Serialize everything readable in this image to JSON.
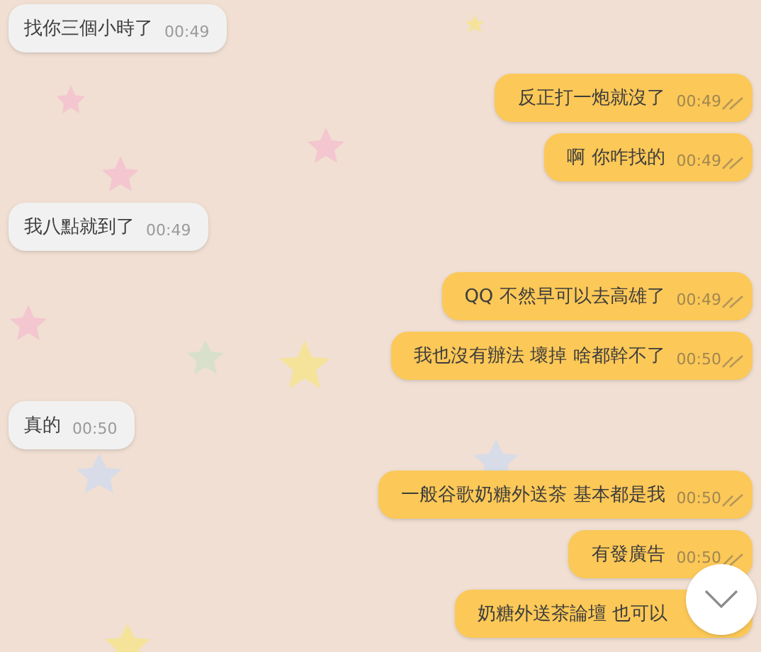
{
  "messages": [
    {
      "kind": "incoming",
      "text": "找你三個小時了",
      "time": "00:49"
    },
    {
      "kind": "outgoing",
      "text": "反正打一炮就沒了",
      "time": "00:49",
      "read": true
    },
    {
      "kind": "outgoing",
      "text": "啊 你咋找的",
      "time": "00:49",
      "read": true
    },
    {
      "kind": "incoming",
      "text": "我八點就到了",
      "time": "00:49"
    },
    {
      "kind": "outgoing",
      "text": "QQ 不然早可以去高雄了",
      "time": "00:49",
      "read": true
    },
    {
      "kind": "outgoing",
      "text": "我也沒有辦法 壞掉 啥都幹不了",
      "time": "00:50",
      "read": true
    },
    {
      "kind": "incoming",
      "text": "真的",
      "time": "00:50"
    },
    {
      "kind": "outgoing",
      "text": "一般谷歌奶糖外送茶 基本都是我",
      "time": "00:50",
      "read": true
    },
    {
      "kind": "outgoing",
      "text": "有發廣告",
      "time": "00:50",
      "read": true
    },
    {
      "kind": "outgoing",
      "text": "奶糖外送茶論壇 也可以"
    }
  ]
}
